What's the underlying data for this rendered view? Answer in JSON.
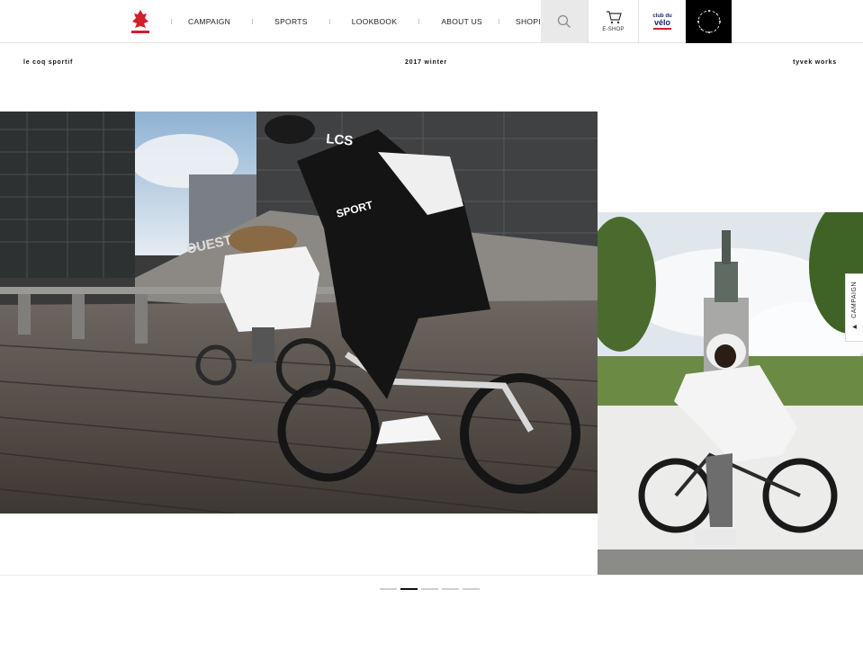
{
  "header": {
    "logo_alt": "le coq sportif",
    "nav": [
      "CAMPAIGN",
      "SPORTS",
      "LOOKBOOK",
      "ABOUT US",
      "SHOPINSTA"
    ],
    "eshop_label": "E-SHOP",
    "club_logo": [
      "club du",
      "vélo"
    ]
  },
  "subbar": {
    "left": "le coq sportif",
    "center": "2017 winter",
    "right": "tyvek works"
  },
  "photo_main": {
    "sign_ouest": "OUEST",
    "jacket_lcs": "LCS",
    "jacket_sport": "SPORT"
  },
  "side_tab": {
    "label": "CAMPAIGN",
    "arrow": "◀"
  },
  "pager": {
    "count": 5,
    "active_index": 1
  },
  "colors": {
    "brand_red": "#d0202a",
    "accent_black": "#000000"
  }
}
